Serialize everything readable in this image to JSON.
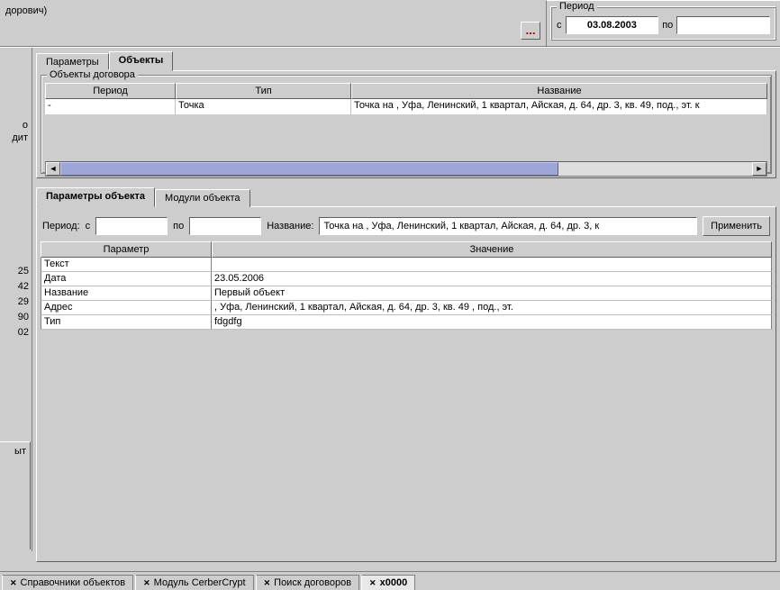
{
  "top": {
    "user_fragment": "дорович)",
    "ellipsis": "..."
  },
  "period_box": {
    "legend": "Период",
    "from_label": "с",
    "from_value": "03.08.2003",
    "to_label": "по",
    "to_value": ""
  },
  "left_strip": {
    "label_o": "о",
    "label_dit": "дит",
    "nums": [
      "25",
      "42",
      "29",
      "90",
      "02"
    ],
    "lower_label": "ыт"
  },
  "top_tabs": {
    "params": "Параметры",
    "objects": "Объекты"
  },
  "objects_fieldset": {
    "legend": "Объекты договора",
    "columns": {
      "period": "Период",
      "type": "Тип",
      "name": "Название"
    },
    "row": {
      "period": "-",
      "type": "Точка",
      "name": "Точка на , Уфа, Ленинский, 1 квартал, Айская, д. 64, др. 3, кв. 49,  под.,  эт. к"
    }
  },
  "obj_tabs": {
    "params": "Параметры объекта",
    "modules": "Модули объекта"
  },
  "obj_form": {
    "period_label": "Период:",
    "from_label": "с",
    "from_value": "",
    "to_label": "по",
    "to_value": "",
    "name_label": "Название:",
    "name_value": "Точка на , Уфа, Ленинский, 1 квартал, Айская, д. 64, др. 3, к",
    "apply_btn": "Применить"
  },
  "params_grid": {
    "columns": {
      "param": "Параметр",
      "value": "Значение"
    },
    "rows": [
      {
        "param": "Текст",
        "value": ""
      },
      {
        "param": "Дата",
        "value": "23.05.2006"
      },
      {
        "param": "Название",
        "value": "Первый объект"
      },
      {
        "param": "Адрес",
        "value": ", Уфа, Ленинский, 1 квартал, Айская, д. 64, др. 3, кв. 49 ,  под.,  эт."
      },
      {
        "param": "Тип",
        "value": "fdgdfg"
      }
    ]
  },
  "window_tabs": {
    "t1": "Справочники объектов",
    "t2": "Модуль CerberCrypt",
    "t3": "Поиск договоров",
    "t4": "x0000"
  }
}
